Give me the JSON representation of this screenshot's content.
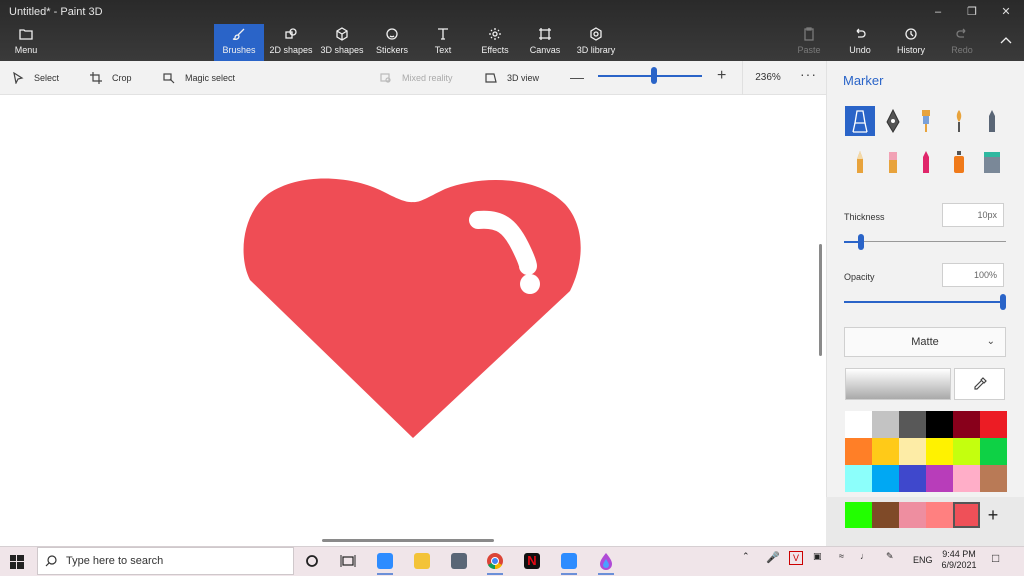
{
  "window": {
    "title": "Untitled* - Paint 3D",
    "controls": {
      "minimize": "–",
      "maximize": "❐",
      "close": "✕"
    }
  },
  "ribbon": {
    "menu_label": "Menu",
    "tabs": [
      {
        "label": "Brushes",
        "icon": "brush-icon",
        "active": true
      },
      {
        "label": "2D shapes",
        "icon": "2d-shapes-icon"
      },
      {
        "label": "3D shapes",
        "icon": "3d-shapes-icon"
      },
      {
        "label": "Stickers",
        "icon": "stickers-icon"
      },
      {
        "label": "Text",
        "icon": "text-icon"
      },
      {
        "label": "Effects",
        "icon": "effects-icon"
      },
      {
        "label": "Canvas",
        "icon": "canvas-icon"
      },
      {
        "label": "3D library",
        "icon": "3d-library-icon"
      }
    ],
    "paste_label": "Paste",
    "undo_label": "Undo",
    "history_label": "History",
    "redo_label": "Redo"
  },
  "toolbar": {
    "select_label": "Select",
    "crop_label": "Crop",
    "magic_select_label": "Magic select",
    "mixed_reality_label": "Mixed reality",
    "view3d_label": "3D view",
    "zoom_value": "236%",
    "zoom_minus": "—",
    "zoom_plus": "+",
    "more": "···"
  },
  "panel": {
    "title": "Marker",
    "brushes": [
      "marker",
      "calligraphy-pen",
      "oil-brush",
      "watercolor",
      "pixel-pen",
      "pencil",
      "eraser",
      "crayon",
      "spray-can",
      "fill"
    ],
    "thickness_label": "Thickness",
    "thickness_value": "10px",
    "opacity_label": "Opacity",
    "opacity_value": "100%",
    "finish": "Matte",
    "palette": [
      "#ffffff",
      "#c3c3c3",
      "#585858",
      "#000000",
      "#88001b",
      "#ec1c24",
      "#ff7f27",
      "#ffca18",
      "#fdeca6",
      "#fff200",
      "#c4ff0e",
      "#0ed145",
      "#8cfffb",
      "#00a8f3",
      "#3f48cc",
      "#b83dba",
      "#ffaec8",
      "#b97a56"
    ],
    "custom_colors": [
      "#22ff00",
      "#7f4a28",
      "#ee8ea0",
      "#ff8080",
      "#ef5058"
    ],
    "add_color": "+"
  },
  "canvas": {
    "heart_color": "#ef4d55",
    "shine_color": "#ffffff"
  },
  "taskbar": {
    "search_placeholder": "Type here to search",
    "language": "ENG",
    "time": "9:44 PM",
    "date": "6/9/2021"
  }
}
